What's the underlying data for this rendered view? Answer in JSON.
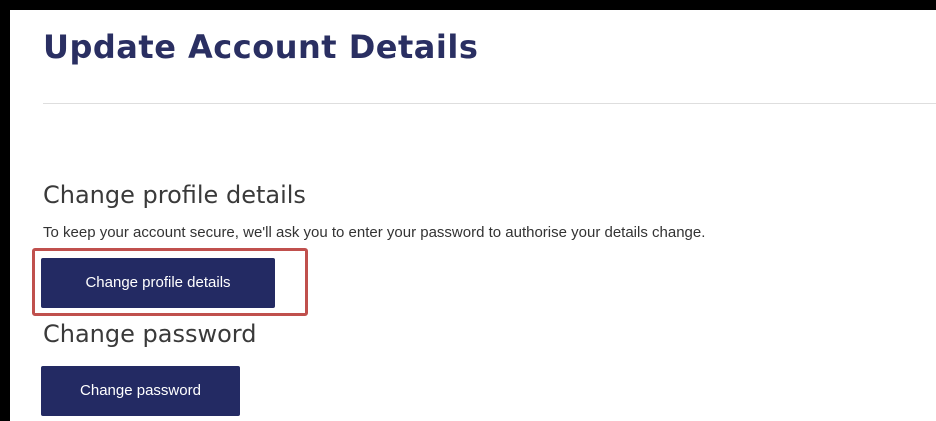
{
  "page": {
    "title": "Update Account Details"
  },
  "profile_section": {
    "heading": "Change profile details",
    "helper_text": "To keep your account secure, we'll ask you to enter your password to authorise your details change.",
    "button_label": "Change profile details"
  },
  "password_section": {
    "heading": "Change password",
    "button_label": "Change password"
  },
  "colors": {
    "title": "#2a2f62",
    "button_bg": "#232a63",
    "highlight_border": "#c0504d",
    "frame_border": "#000000"
  }
}
